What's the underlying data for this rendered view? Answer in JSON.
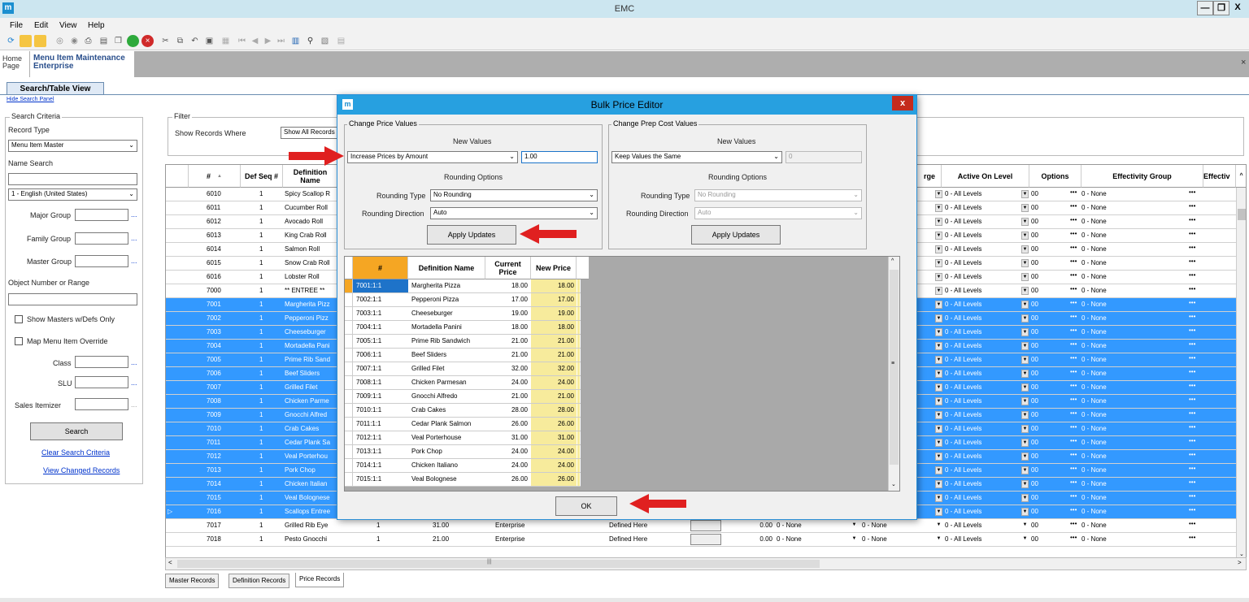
{
  "window": {
    "title": "EMC",
    "logo": "m",
    "min": "—",
    "restore": "❐",
    "close": "X"
  },
  "menu": [
    "File",
    "Edit",
    "View",
    "Help"
  ],
  "tabs": {
    "home_line1": "Home",
    "home_line2": "Page",
    "module_line1": "Menu Item Maintenance",
    "module_line2": "Enterprise",
    "close": "×"
  },
  "search_tab": "Search/Table View",
  "hide_search_panel": "Hide Search Panel",
  "criteria": {
    "legend": "Search Criteria",
    "record_type_label": "Record Type",
    "record_type_value": "Menu Item Master",
    "name_search_label": "Name Search",
    "name_search_value": "",
    "language_value": "1 - English (United States)",
    "major_group_label": "Major Group",
    "family_group_label": "Family Group",
    "master_group_label": "Master Group",
    "object_number_label": "Object Number or Range",
    "show_masters_label": "Show Masters w/Defs Only",
    "map_override_label": "Map Menu Item Override",
    "class_label": "Class",
    "slu_label": "SLU",
    "sales_itemizer_label": "Sales Itemizer",
    "search_button": "Search",
    "clear_link": "Clear Search Criteria",
    "changed_link": "View Changed Records",
    "ellipsis": "..."
  },
  "filter": {
    "legend": "Filter",
    "show_label": "Show Records Where",
    "show_value": "Show All Records"
  },
  "grid": {
    "headers": {
      "num": "#",
      "defseq": "Def Seq #",
      "defname": "Definition Name",
      "rge": "rge",
      "active": "Active On Level",
      "options": "Options",
      "eff_group": "Effectivity Group",
      "effective": "Effectiv"
    },
    "active_value": "0 - All Levels",
    "options_value": "00",
    "eff_value": "0 - None",
    "rows": [
      {
        "num": "6010",
        "seq": "1",
        "name": "Spicy Scallop R",
        "sel": false
      },
      {
        "num": "6011",
        "seq": "1",
        "name": "Cucumber Roll",
        "sel": false
      },
      {
        "num": "6012",
        "seq": "1",
        "name": "Avocado Roll",
        "sel": false
      },
      {
        "num": "6013",
        "seq": "1",
        "name": "King Crab Roll",
        "sel": false
      },
      {
        "num": "6014",
        "seq": "1",
        "name": "Salmon Roll",
        "sel": false
      },
      {
        "num": "6015",
        "seq": "1",
        "name": "Snow Crab Roll",
        "sel": false
      },
      {
        "num": "6016",
        "seq": "1",
        "name": "Lobster Roll",
        "sel": false
      },
      {
        "num": "7000",
        "seq": "1",
        "name": "** ENTREE **",
        "sel": false
      },
      {
        "num": "7001",
        "seq": "1",
        "name": "Margherita Pizz",
        "sel": true
      },
      {
        "num": "7002",
        "seq": "1",
        "name": "Pepperoni Pizz",
        "sel": true
      },
      {
        "num": "7003",
        "seq": "1",
        "name": "Cheeseburger",
        "sel": true
      },
      {
        "num": "7004",
        "seq": "1",
        "name": "Mortadella Pani",
        "sel": true
      },
      {
        "num": "7005",
        "seq": "1",
        "name": "Prime Rib Sand",
        "sel": true
      },
      {
        "num": "7006",
        "seq": "1",
        "name": "Beef Sliders",
        "sel": true
      },
      {
        "num": "7007",
        "seq": "1",
        "name": "Grilled Filet",
        "sel": true
      },
      {
        "num": "7008",
        "seq": "1",
        "name": "Chicken Parme",
        "sel": true
      },
      {
        "num": "7009",
        "seq": "1",
        "name": "Gnocchi Alfred",
        "sel": true
      },
      {
        "num": "7010",
        "seq": "1",
        "name": "Crab Cakes",
        "sel": true
      },
      {
        "num": "7011",
        "seq": "1",
        "name": "Cedar Plank Sa",
        "sel": true
      },
      {
        "num": "7012",
        "seq": "1",
        "name": "Veal Porterhou",
        "sel": true
      },
      {
        "num": "7013",
        "seq": "1",
        "name": "Pork Chop",
        "sel": true
      },
      {
        "num": "7014",
        "seq": "1",
        "name": "Chicken Italian",
        "sel": true
      },
      {
        "num": "7015",
        "seq": "1",
        "name": "Veal Bolognese",
        "sel": true
      },
      {
        "num": "7016",
        "seq": "1",
        "name": "Scallops Entree",
        "sel": true
      }
    ],
    "extra_rows": [
      {
        "num": "7017",
        "seq": "1",
        "name": "Grilled Rib Eye",
        "lvl": "1",
        "price": "31.00",
        "ent": "Enterprise",
        "def": "Defined Here",
        "prep": "0.00",
        "c1": "0 - None",
        "c2": "0 - None"
      },
      {
        "num": "7018",
        "seq": "1",
        "name": "Pesto Gnocchi",
        "lvl": "1",
        "price": "21.00",
        "ent": "Enterprise",
        "def": "Defined Here",
        "prep": "0.00",
        "c1": "0 - None",
        "c2": "0 - None"
      }
    ]
  },
  "bottom_tabs": [
    "Master Records",
    "Definition Records",
    "Price Records"
  ],
  "dialog": {
    "title": "Bulk Price Editor",
    "logo": "m",
    "close": "x",
    "price_group": "Change Price Values",
    "prep_group": "Change Prep Cost Values",
    "new_values": "New Values",
    "price_mode": "Increase Prices by Amount",
    "price_amount": "1.00",
    "prep_mode": "Keep Values the Same",
    "prep_amount": "0",
    "rounding_options": "Rounding Options",
    "rounding_type_label": "Rounding Type",
    "rounding_type_value": "No Rounding",
    "rounding_dir_label": "Rounding Direction",
    "rounding_dir_value": "Auto",
    "apply_button": "Apply Updates",
    "ok_button": "OK",
    "inner_headers": {
      "num": "#",
      "name": "Definition Name",
      "current": "Current Price",
      "new": "New Price"
    },
    "inner_rows": [
      {
        "num": "7001:1:1",
        "name": "Margherita Pizza",
        "cur": "18.00",
        "new": "18.00"
      },
      {
        "num": "7002:1:1",
        "name": "Pepperoni Pizza",
        "cur": "17.00",
        "new": "17.00"
      },
      {
        "num": "7003:1:1",
        "name": "Cheeseburger",
        "cur": "19.00",
        "new": "19.00"
      },
      {
        "num": "7004:1:1",
        "name": "Mortadella Panini",
        "cur": "18.00",
        "new": "18.00"
      },
      {
        "num": "7005:1:1",
        "name": "Prime Rib Sandwich",
        "cur": "21.00",
        "new": "21.00"
      },
      {
        "num": "7006:1:1",
        "name": "Beef Sliders",
        "cur": "21.00",
        "new": "21.00"
      },
      {
        "num": "7007:1:1",
        "name": "Grilled Filet",
        "cur": "32.00",
        "new": "32.00"
      },
      {
        "num": "7008:1:1",
        "name": "Chicken Parmesan",
        "cur": "24.00",
        "new": "24.00"
      },
      {
        "num": "7009:1:1",
        "name": "Gnocchi Alfredo",
        "cur": "21.00",
        "new": "21.00"
      },
      {
        "num": "7010:1:1",
        "name": "Crab Cakes",
        "cur": "28.00",
        "new": "28.00"
      },
      {
        "num": "7011:1:1",
        "name": "Cedar Plank Salmon",
        "cur": "26.00",
        "new": "26.00"
      },
      {
        "num": "7012:1:1",
        "name": "Veal Porterhouse",
        "cur": "31.00",
        "new": "31.00"
      },
      {
        "num": "7013:1:1",
        "name": "Pork Chop",
        "cur": "24.00",
        "new": "24.00"
      },
      {
        "num": "7014:1:1",
        "name": "Chicken Italiano",
        "cur": "24.00",
        "new": "24.00"
      },
      {
        "num": "7015:1:1",
        "name": "Veal Bolognese",
        "cur": "26.00",
        "new": "26.00"
      }
    ]
  },
  "colors": {
    "selection": "#3399ff",
    "accent": "#27a0e0",
    "arrow": "#e02020",
    "new_price": "#f7eb9c"
  }
}
